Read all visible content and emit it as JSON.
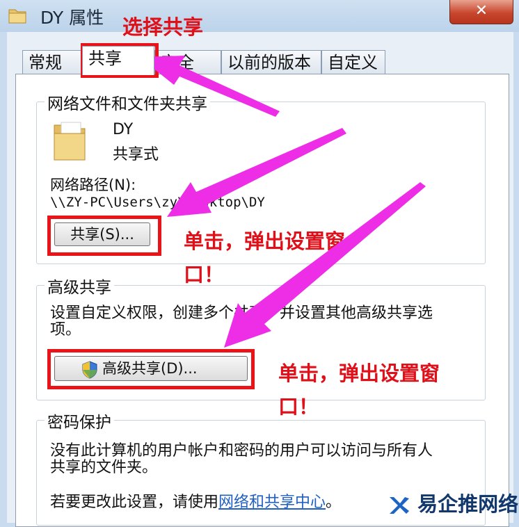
{
  "window": {
    "title": "DY 属性",
    "close_glyph": "✕"
  },
  "tabs": [
    {
      "label": "常规",
      "active": false
    },
    {
      "label": "共享",
      "active": true
    },
    {
      "label": "安全",
      "active": false
    },
    {
      "label": "以前的版本",
      "active": false
    },
    {
      "label": "自定义",
      "active": false
    }
  ],
  "network_sharing": {
    "title": "网络文件和文件夹共享",
    "folder_name": "DY",
    "share_state": "共享式",
    "path_label": "网络路径(N):",
    "path_value": "\\\\ZY-PC\\Users\\zy\\Desktop\\DY",
    "share_button": "共享(S)..."
  },
  "advanced_sharing": {
    "title": "高级共享",
    "description_line1": "设置自定义权限，创建多个共享，并设置其他高级共享选",
    "description_line2": "项。",
    "button": "高级共享(D)..."
  },
  "password_protection": {
    "title": "密码保护",
    "description_line1": "没有此计算机的用户帐户和密码的用户可以访问与所有人",
    "description_line2": "共享的文件夹。",
    "change_prefix": "若要更改此设置，请使用",
    "link": "网络和共享中心",
    "change_suffix": "。"
  },
  "annotations": {
    "select_share": "选择共享",
    "click1_line1": "单击，弹出设置窗",
    "click1_line2": "口！",
    "click2_line1": "单击，弹出设置窗",
    "click2_line2": "口！",
    "accent_red": "#e8141a",
    "arrow_color": "#ee2ee6"
  },
  "watermark": {
    "text": "易企推网络",
    "color": "#13386d"
  },
  "icons": [
    "folder-icon",
    "shield-icon",
    "close-icon"
  ]
}
